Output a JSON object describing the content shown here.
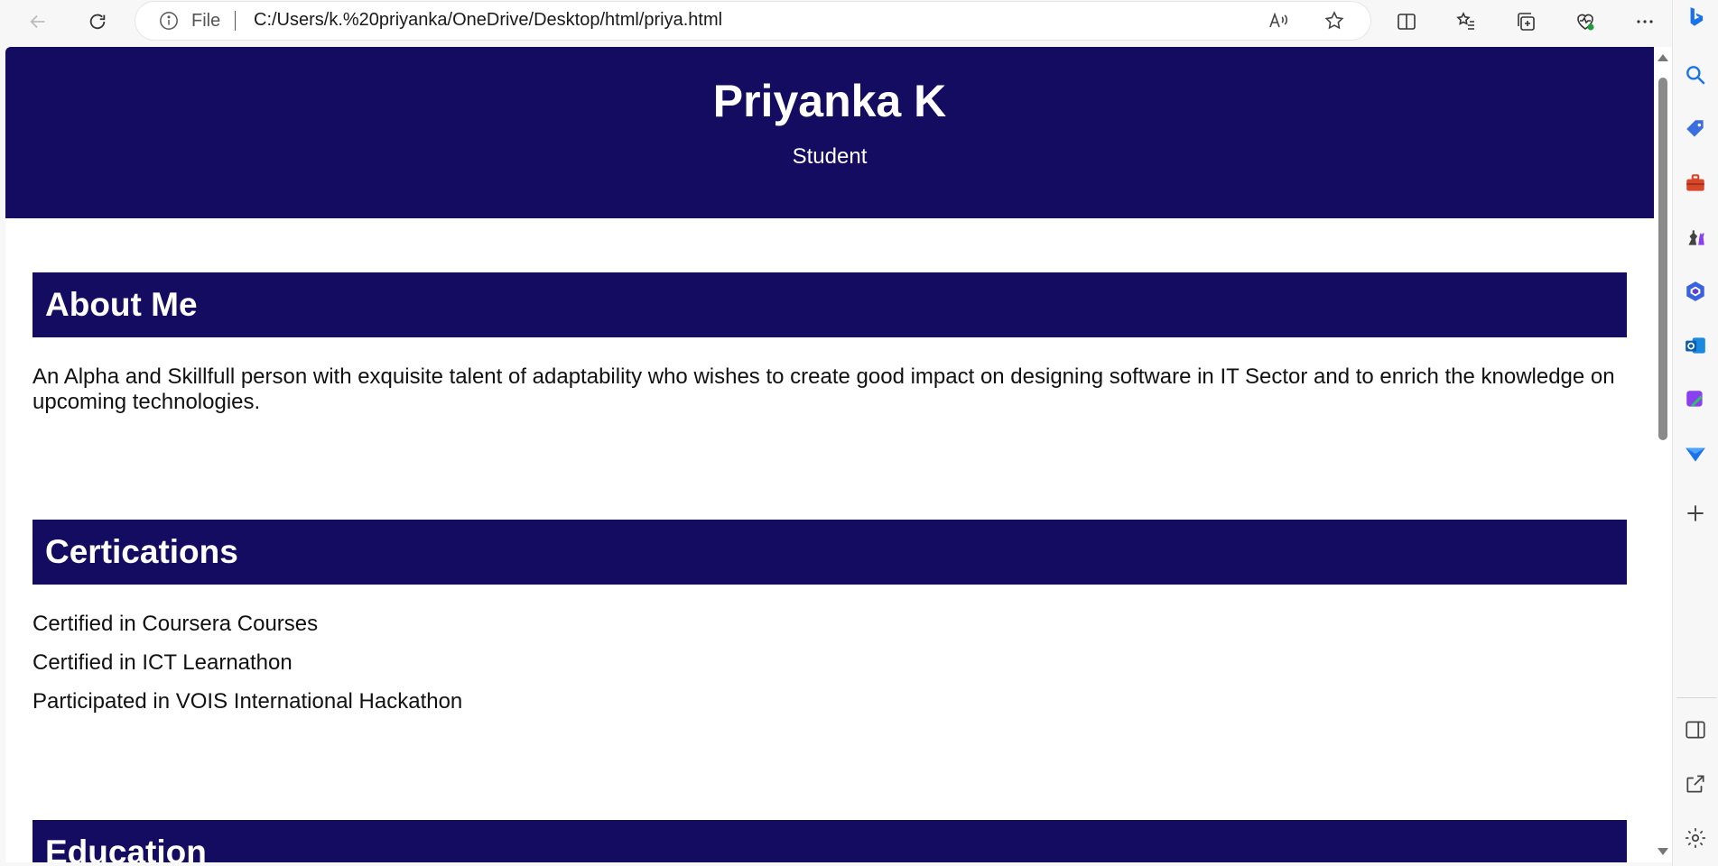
{
  "browser": {
    "address_prefix": "File",
    "url": "C:/Users/k.%20priyanka/OneDrive/Desktop/html/priya.html"
  },
  "page": {
    "header": {
      "name": "Priyanka K",
      "role": "Student"
    },
    "about": {
      "title": "About Me",
      "text": "An Alpha and Skillfull person with exquisite talent of adaptability who wishes to create good impact on designing software in IT Sector and to enrich the knowledge on upcoming technologies."
    },
    "certifications": {
      "title": "Certications",
      "items": [
        "Certified in Coursera Courses",
        "Certified in ICT Learnathon",
        "Participated in VOIS International Hackathon"
      ]
    },
    "education": {
      "title": "Education"
    }
  },
  "colors": {
    "header_bg": "#130c60",
    "section_bg": "#130c60",
    "text": "#111111"
  }
}
